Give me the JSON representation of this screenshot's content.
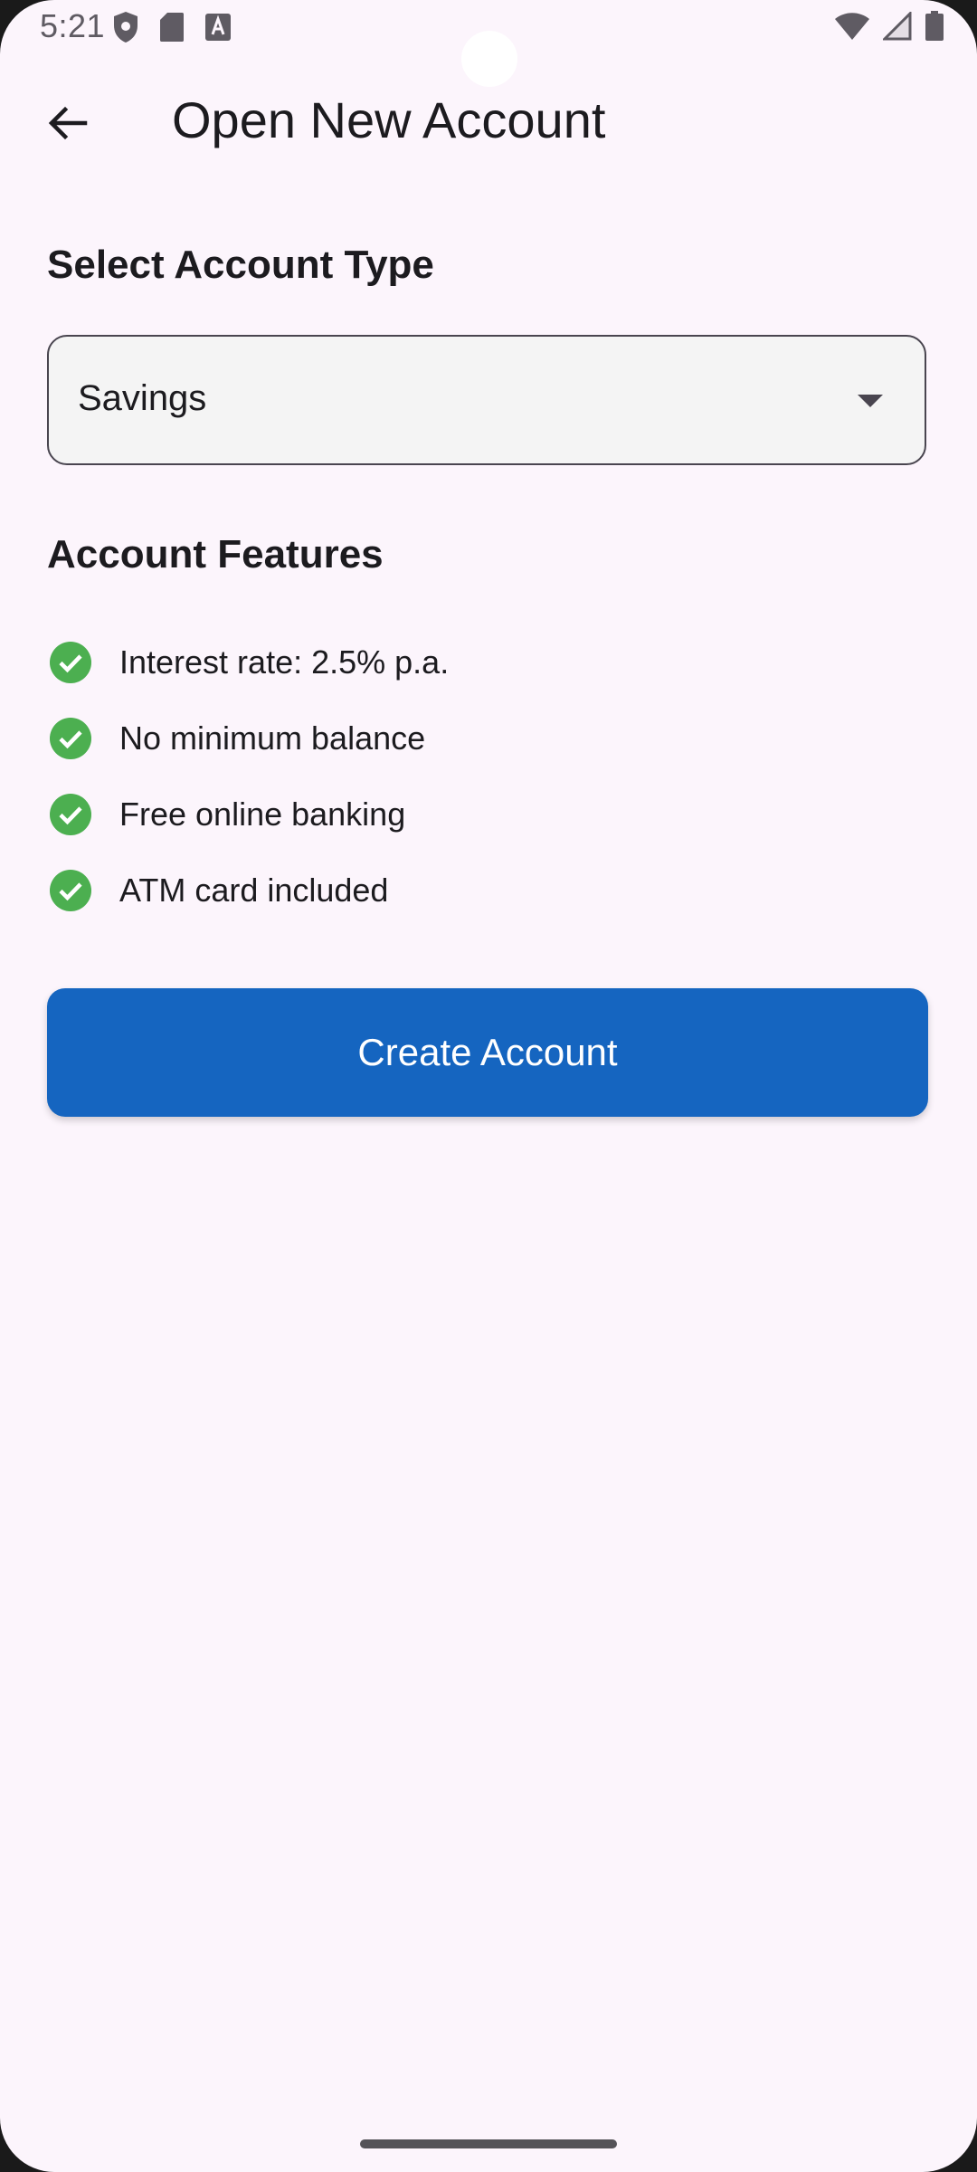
{
  "status_bar": {
    "time": "5:21",
    "left_icons": [
      "shield-icon",
      "sd-card-icon",
      "font-icon"
    ],
    "right_icons": [
      "wifi-icon",
      "cell-signal-icon",
      "battery-icon"
    ]
  },
  "app_bar": {
    "back_icon": "arrow-back-icon",
    "title": "Open New Account"
  },
  "account_type": {
    "heading": "Select Account Type",
    "selected": "Savings"
  },
  "features": {
    "heading": "Account Features",
    "items": [
      "Interest rate: 2.5% p.a.",
      "No minimum balance",
      "Free online banking",
      "ATM card included"
    ],
    "check_color": "#4caf50"
  },
  "actions": {
    "create_label": "Create Account",
    "create_color": "#1565c0"
  }
}
